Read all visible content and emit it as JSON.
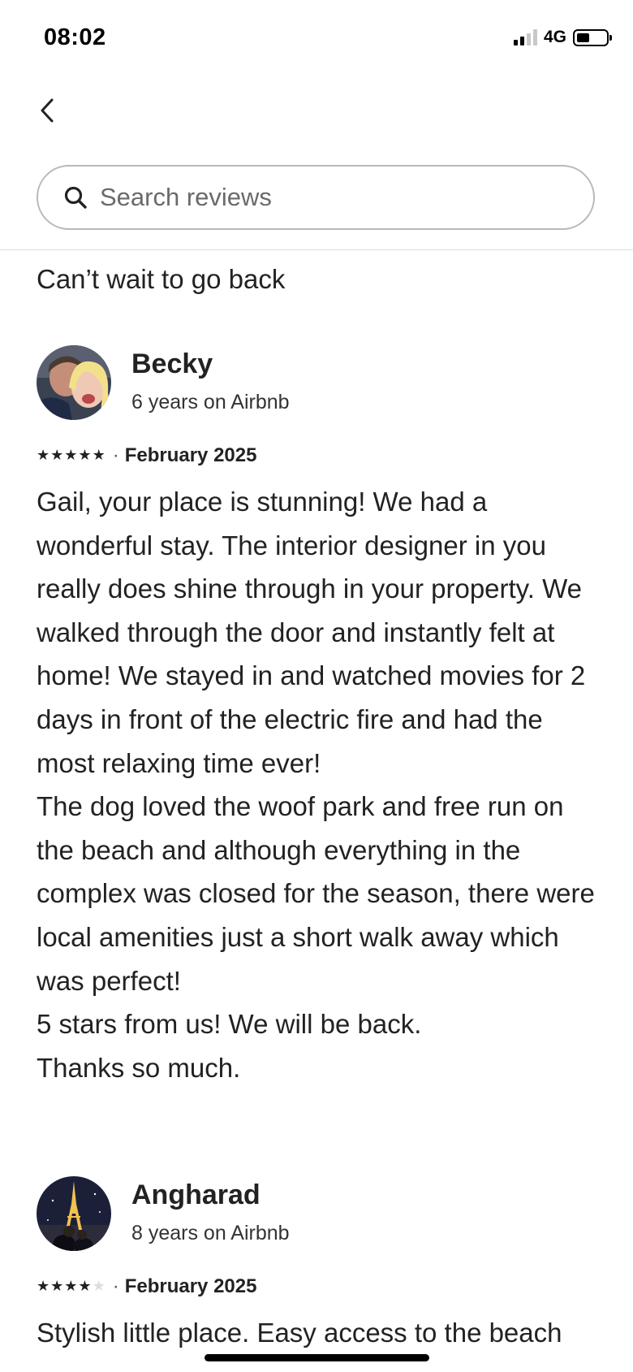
{
  "status_bar": {
    "time": "08:02",
    "network": "4G",
    "signal_bars_active": 2,
    "signal_bars_total": 4,
    "battery_level": 0.45
  },
  "search": {
    "placeholder": "Search reviews"
  },
  "previous_review_tail": "Can’t wait to go back",
  "reviews": [
    {
      "name": "Becky",
      "tenure": "6 years on Airbnb",
      "rating": 5,
      "date": "February 2025",
      "paragraphs": [
        "Gail, your place is stunning! We had a wonderful stay. The interior designer in you really does shine through in your property. We walked through the door and instantly felt at home! We stayed in and watched movies for 2 days in front of the electric fire and had the most relaxing time ever!",
        "The dog loved the woof park and free run on the beach and although everything in the complex was closed for the season, there were local amenities just a short walk away which was perfect!",
        "5 stars from us! We will be back.",
        "Thanks so much."
      ]
    },
    {
      "name": "Angharad",
      "tenure": "8 years on Airbnb",
      "rating": 4,
      "date": "February 2025",
      "paragraphs": [
        "Stylish little place. Easy access to the beach"
      ]
    }
  ],
  "meta_separator": "·",
  "colors": {
    "text": "#222222",
    "border": "#b9b9b9",
    "divider": "#dddddd",
    "star_empty": "#dddddd"
  }
}
